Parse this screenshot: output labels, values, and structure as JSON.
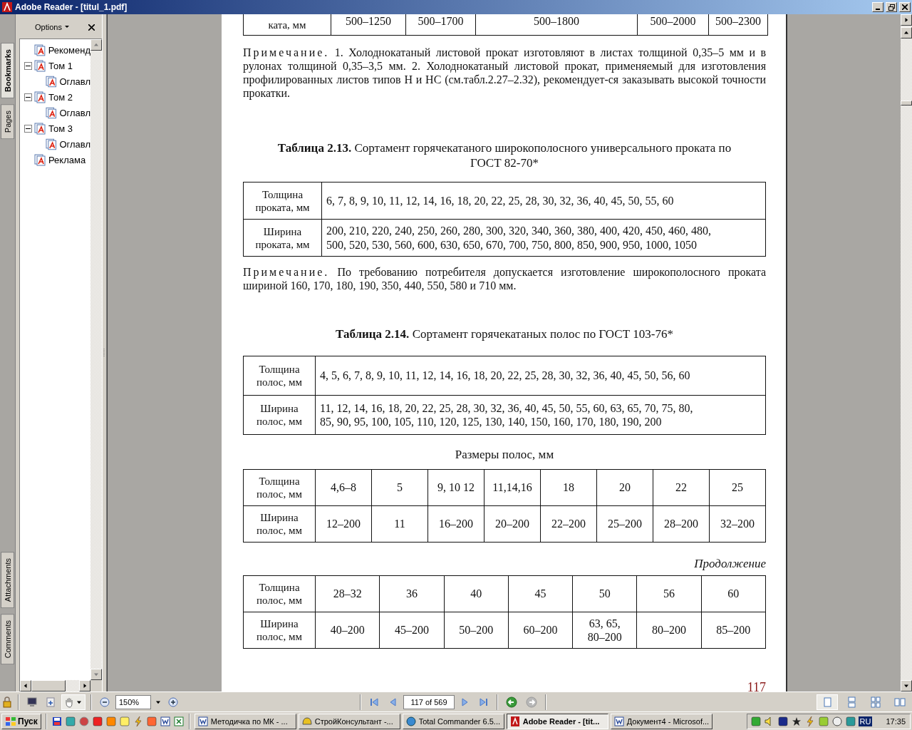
{
  "window": {
    "title": "Adobe Reader - [titul_1.pdf]"
  },
  "side_tabs_top": [
    {
      "label": "Bookmarks",
      "selected": true
    },
    {
      "label": "Pages",
      "selected": false
    }
  ],
  "side_tabs_bottom": [
    {
      "label": "Attachments",
      "selected": false
    },
    {
      "label": "Comments",
      "selected": false
    }
  ],
  "bookmarks_panel": {
    "options_label": "Options",
    "tree": [
      {
        "label": "Рекоменд"
      },
      {
        "label": "Том 1",
        "expanded": true,
        "children": [
          {
            "label": "Оглавл"
          }
        ]
      },
      {
        "label": "Том 2",
        "expanded": true,
        "children": [
          {
            "label": "Оглавл"
          }
        ]
      },
      {
        "label": "Том 3",
        "expanded": true,
        "children": [
          {
            "label": "Оглавл"
          }
        ]
      },
      {
        "label": "Реклама"
      }
    ]
  },
  "document": {
    "top_table": {
      "header": "ката, мм",
      "values": [
        "500–1250",
        "500–1700",
        "500–1800",
        "500–2000",
        "500–2300"
      ]
    },
    "note_1": {
      "label": "Примечание.",
      "text": "1. Холоднокатаный листовой прокат изготовляют в листах толщиной 0,35–5 мм и в рулонах толщиной 0,35–3,5 мм. 2. Холоднокатаный листовой прокат, применяемый для изготовления профилированных листов типов Н и НС (см.табл.2.27–2.32), рекомендует-ся заказывать высокой точности прокатки."
    },
    "table_2_13": {
      "caption": "**Таблица 2.13.** Сортамент горячекатаного широкополосного универсального проката по ГОСТ 82-70*",
      "rows": [
        {
          "header": "Толщина\nпроката, мм",
          "value": "6, 7, 8, 9, 10, 11, 12, 14, 16, 18, 20, 22, 25, 28, 30, 32, 36, 40, 45, 50, 55, 60"
        },
        {
          "header": "Ширина\nпроката, мм",
          "value": "200, 210, 220, 240, 250, 260, 280, 300, 320, 340, 360, 380, 400, 420, 450, 460, 480,\n500, 520, 530, 560, 600, 630, 650, 670, 700, 750, 800, 850, 900, 950, 1000, 1050"
        }
      ]
    },
    "note_2": {
      "label": "Примечание.",
      "text": "По требованию потребителя допускается изготовление широкополосного проката шириной 160, 170, 180, 190, 350, 440, 550, 580 и 710 мм."
    },
    "table_2_14": {
      "caption": "**Таблица 2.14.** Сортамент горячекатаных полос по ГОСТ 103-76*",
      "rows": [
        {
          "header": "Толщина\nполос, мм",
          "value": "4, 5, 6, 7, 8, 9, 10, 11, 12, 14, 16, 18, 20, 22, 25, 28, 30, 32, 36, 40, 45, 50, 56, 60"
        },
        {
          "header": "Ширина\nполос, мм",
          "value": "11, 12, 14, 16, 18, 20, 22, 25, 28, 30, 32, 36, 40, 45, 50, 55, 60, 63, 65, 70, 75, 80,\n85, 90, 95, 100, 105, 110, 120, 125, 130, 140, 150, 160, 170, 180, 190, 200"
        }
      ]
    },
    "sizes_title": "Размеры полос, мм",
    "sizes_table": {
      "rows": [
        {
          "header": "Толщина\nполос, мм",
          "values": [
            "4,6–8",
            "5",
            "9, 10 12",
            "11,14,16",
            "18",
            "20",
            "22",
            "25"
          ]
        },
        {
          "header": "Ширина\nполос, мм",
          "values": [
            "12–200",
            "11",
            "16–200",
            "20–200",
            "22–200",
            "25–200",
            "28–200",
            "32–200"
          ]
        }
      ]
    },
    "continuation_label": "Продолжение",
    "continuation_table": {
      "rows": [
        {
          "header": "Толщина\nполос, мм",
          "values": [
            "28–32",
            "36",
            "40",
            "45",
            "50",
            "56",
            "60"
          ]
        },
        {
          "header": "Ширина\nполос, мм",
          "values": [
            "40–200",
            "45–200",
            "50–200",
            "60–200",
            "63, 65,\n80–200",
            "80–200",
            "85–200"
          ]
        }
      ]
    },
    "page_number": "117"
  },
  "toolbar": {
    "zoom": "150%",
    "page_field": "117 of 569",
    "history": [
      {
        "kind": "back",
        "disabled": false
      },
      {
        "kind": "forward",
        "disabled": true
      }
    ],
    "view_modes": [
      {
        "kind": "single",
        "selected": true
      },
      {
        "kind": "continuous",
        "selected": false
      },
      {
        "kind": "continuous-facing",
        "selected": false
      },
      {
        "kind": "facing",
        "selected": false
      }
    ]
  },
  "taskbar": {
    "start": "Пуск",
    "tasks": [
      {
        "label": "Методичка по МК - ...",
        "kind": "word",
        "selected": false
      },
      {
        "label": "СтройКонсультант -...",
        "kind": "helmet",
        "selected": false
      },
      {
        "label": "Total Commander 6.5...",
        "kind": "globe",
        "selected": false
      },
      {
        "label": "Adobe Reader - [tit...",
        "kind": "reader",
        "selected": true
      },
      {
        "label": "Документ4 - Microsof...",
        "kind": "word",
        "selected": false
      }
    ],
    "language": "RU",
    "clock": "17:35"
  }
}
